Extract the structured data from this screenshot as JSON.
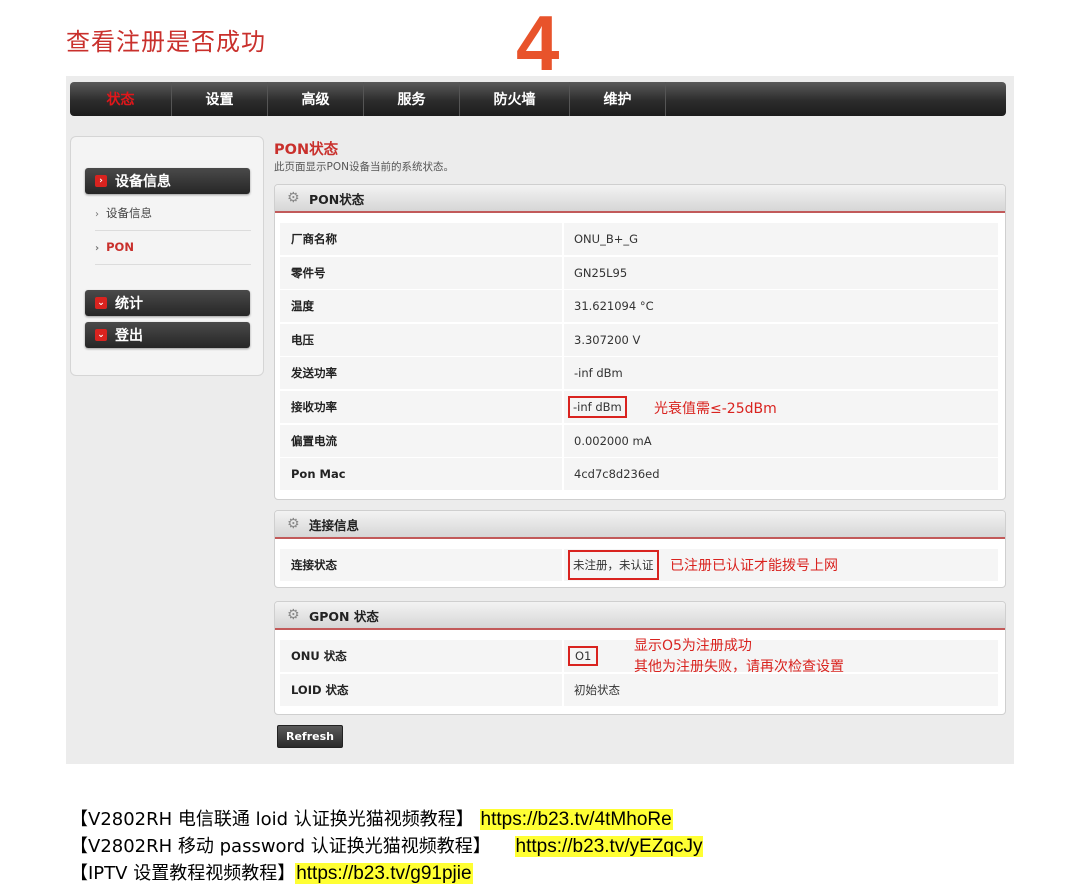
{
  "doc": {
    "title": "查看注册是否成功",
    "step": "4"
  },
  "nav": {
    "items": [
      "状态",
      "设置",
      "高级",
      "服务",
      "防火墙",
      "维护"
    ]
  },
  "sidebar": {
    "device_info_header": "设备信息",
    "sub_device_info": "设备信息",
    "sub_pon": "PON",
    "stats_header": "统计",
    "logout_header": "登出",
    "arrow_icon": "›"
  },
  "main": {
    "title": "PON状态",
    "desc": "此页面显示PON设备当前的系统状态。"
  },
  "pon_panel": {
    "title": "PON状态",
    "rows": [
      {
        "key": "厂商名称",
        "value": "ONU_B+_G"
      },
      {
        "key": "零件号",
        "value": "GN25L95"
      },
      {
        "key": "温度",
        "value": "31.621094 °C"
      },
      {
        "key": "电压",
        "value": "3.307200 V"
      },
      {
        "key": "发送功率",
        "value": "-inf dBm"
      },
      {
        "key": "接收功率",
        "value": "-inf dBm"
      },
      {
        "key": "偏置电流",
        "value": "0.002000 mA"
      },
      {
        "key": "Pon Mac",
        "value": "4cd7c8d236ed"
      }
    ]
  },
  "conn_panel": {
    "title": "连接信息",
    "rows": [
      {
        "key": "连接状态",
        "value": "未注册，未认证"
      }
    ]
  },
  "gpon_panel": {
    "title": "GPON 状态",
    "rows": [
      {
        "key": "ONU 状态",
        "value": "O1"
      },
      {
        "key": "LOID 状态",
        "value": "初始状态"
      }
    ]
  },
  "notes": {
    "rx_power": "光衰值需≤-25dBm",
    "conn": "已注册已认证才能拨号上网",
    "onu_line1": "显示O5为注册成功",
    "onu_line2": "其他为注册失败，请再次检查设置"
  },
  "refresh_label": "Refresh",
  "links": [
    {
      "text": "【V2802RH 电信联通 loid 认证换光猫视频教程】",
      "url": "https://b23.tv/4tMhoRe"
    },
    {
      "text": "【V2802RH 移动 password 认证换光猫视频教程】",
      "url": "https://b23.tv/yEZqcJy"
    },
    {
      "text": "【IPTV 设置教程视频教程】",
      "url": "https://b23.tv/g91pjie"
    }
  ],
  "colors": {
    "accent_red": "#d9231f",
    "highlight_yellow": "#ffff33"
  },
  "icons": {
    "gear": "gear-icon"
  }
}
